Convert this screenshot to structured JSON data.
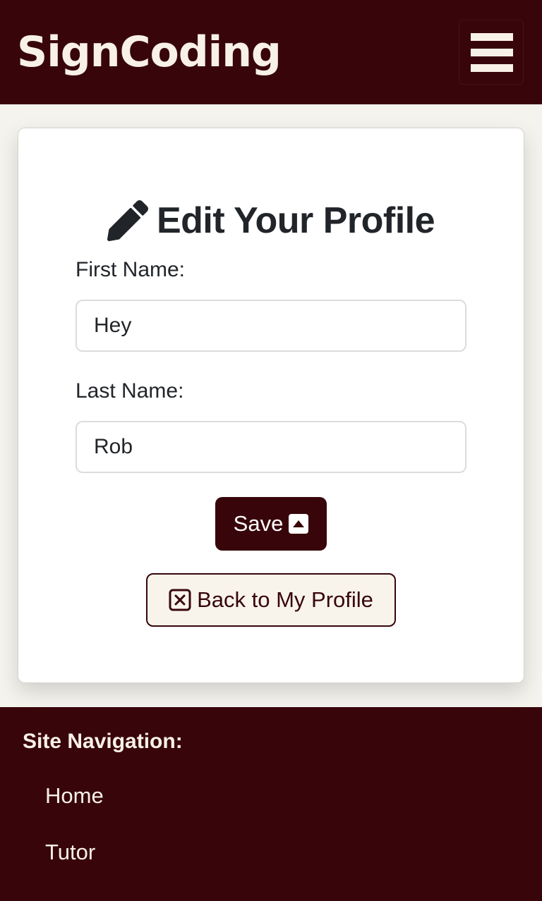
{
  "header": {
    "brand": "SignCoding",
    "menu_icon": "hamburger-menu-icon"
  },
  "form": {
    "title": "Edit Your Profile",
    "title_icon": "pencil-icon",
    "first_name_label": "First Name:",
    "first_name_value": "Hey",
    "last_name_label": "Last Name:",
    "last_name_value": "Rob",
    "save_label": "Save",
    "save_icon": "caret-square-up-icon",
    "back_label": "Back to My Profile",
    "back_icon": "x-square-icon"
  },
  "footer": {
    "nav_title": "Site Navigation:",
    "links": [
      "Home",
      "Tutor"
    ]
  },
  "colors": {
    "brand_dark": "#38060a",
    "cream": "#f8f1e7",
    "page_bg": "#f5f3ee"
  }
}
